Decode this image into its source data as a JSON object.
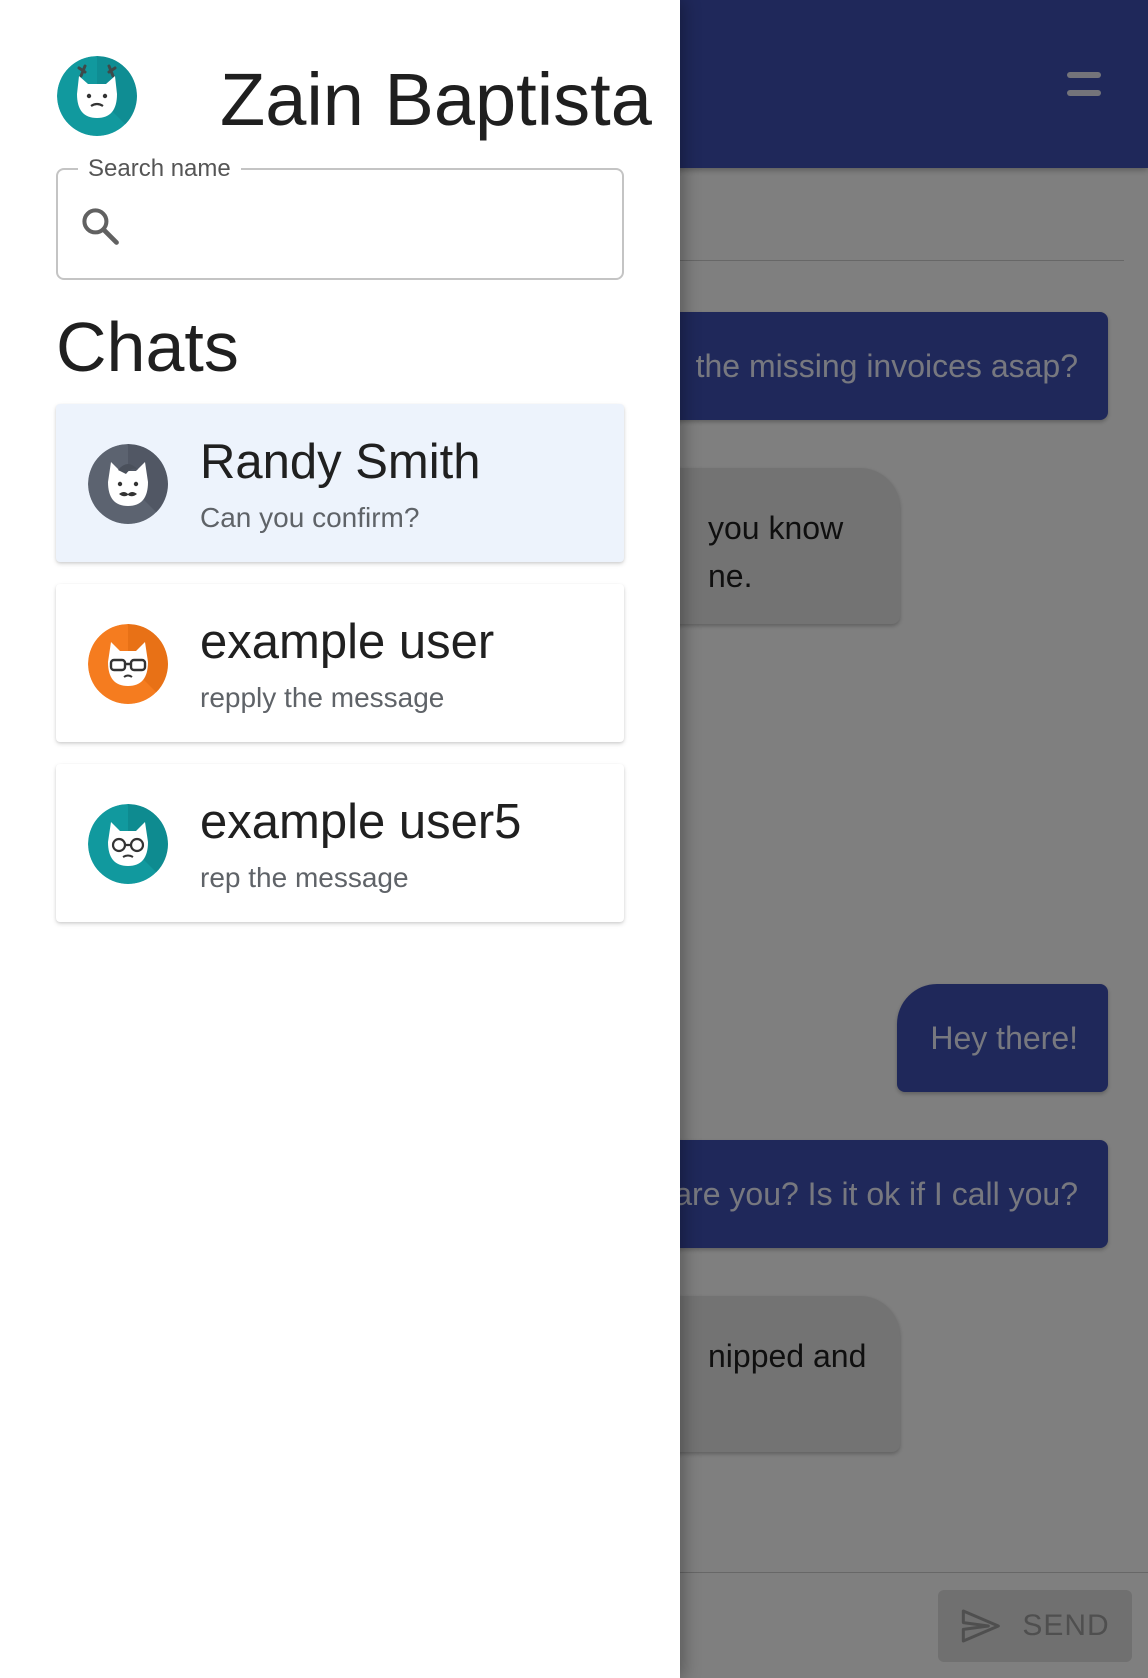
{
  "app": {
    "messages": [
      {
        "text": "the missing invoices asap?",
        "direction": "out"
      },
      {
        "text": "you know",
        "text2": "ne.",
        "direction": "in"
      },
      {
        "text": "Hey there!",
        "direction": "out"
      },
      {
        "text": "are you? Is it ok if I call you?",
        "direction": "out"
      },
      {
        "text": "nipped and",
        "text2": "",
        "direction": "in"
      }
    ],
    "send_label": "SEND",
    "colors": {
      "primary": "#3f51b5",
      "incoming_bubble": "#e6e6e6"
    }
  },
  "drawer": {
    "user": {
      "name": "Zain Baptista",
      "avatar_icon": "teal-cat-antlers-avatar"
    },
    "search": {
      "label": "Search name",
      "value": "",
      "icon": "search-icon"
    },
    "chats_title": "Chats",
    "chats": [
      {
        "name": "Randy Smith",
        "preview": "Can you confirm?",
        "selected": true,
        "avatar_icon": "gray-cat-mustache-avatar",
        "avatar_color": "#5c6370"
      },
      {
        "name": "example user",
        "preview": "repply the message",
        "selected": false,
        "avatar_icon": "orange-cat-glasses-avatar",
        "avatar_color": "#f57c1f"
      },
      {
        "name": "example user5",
        "preview": "rep the message",
        "selected": false,
        "avatar_icon": "teal-cat-round-glasses-avatar",
        "avatar_color": "#11999e"
      }
    ],
    "colors": {
      "selected_item": "#edf3fc"
    }
  }
}
